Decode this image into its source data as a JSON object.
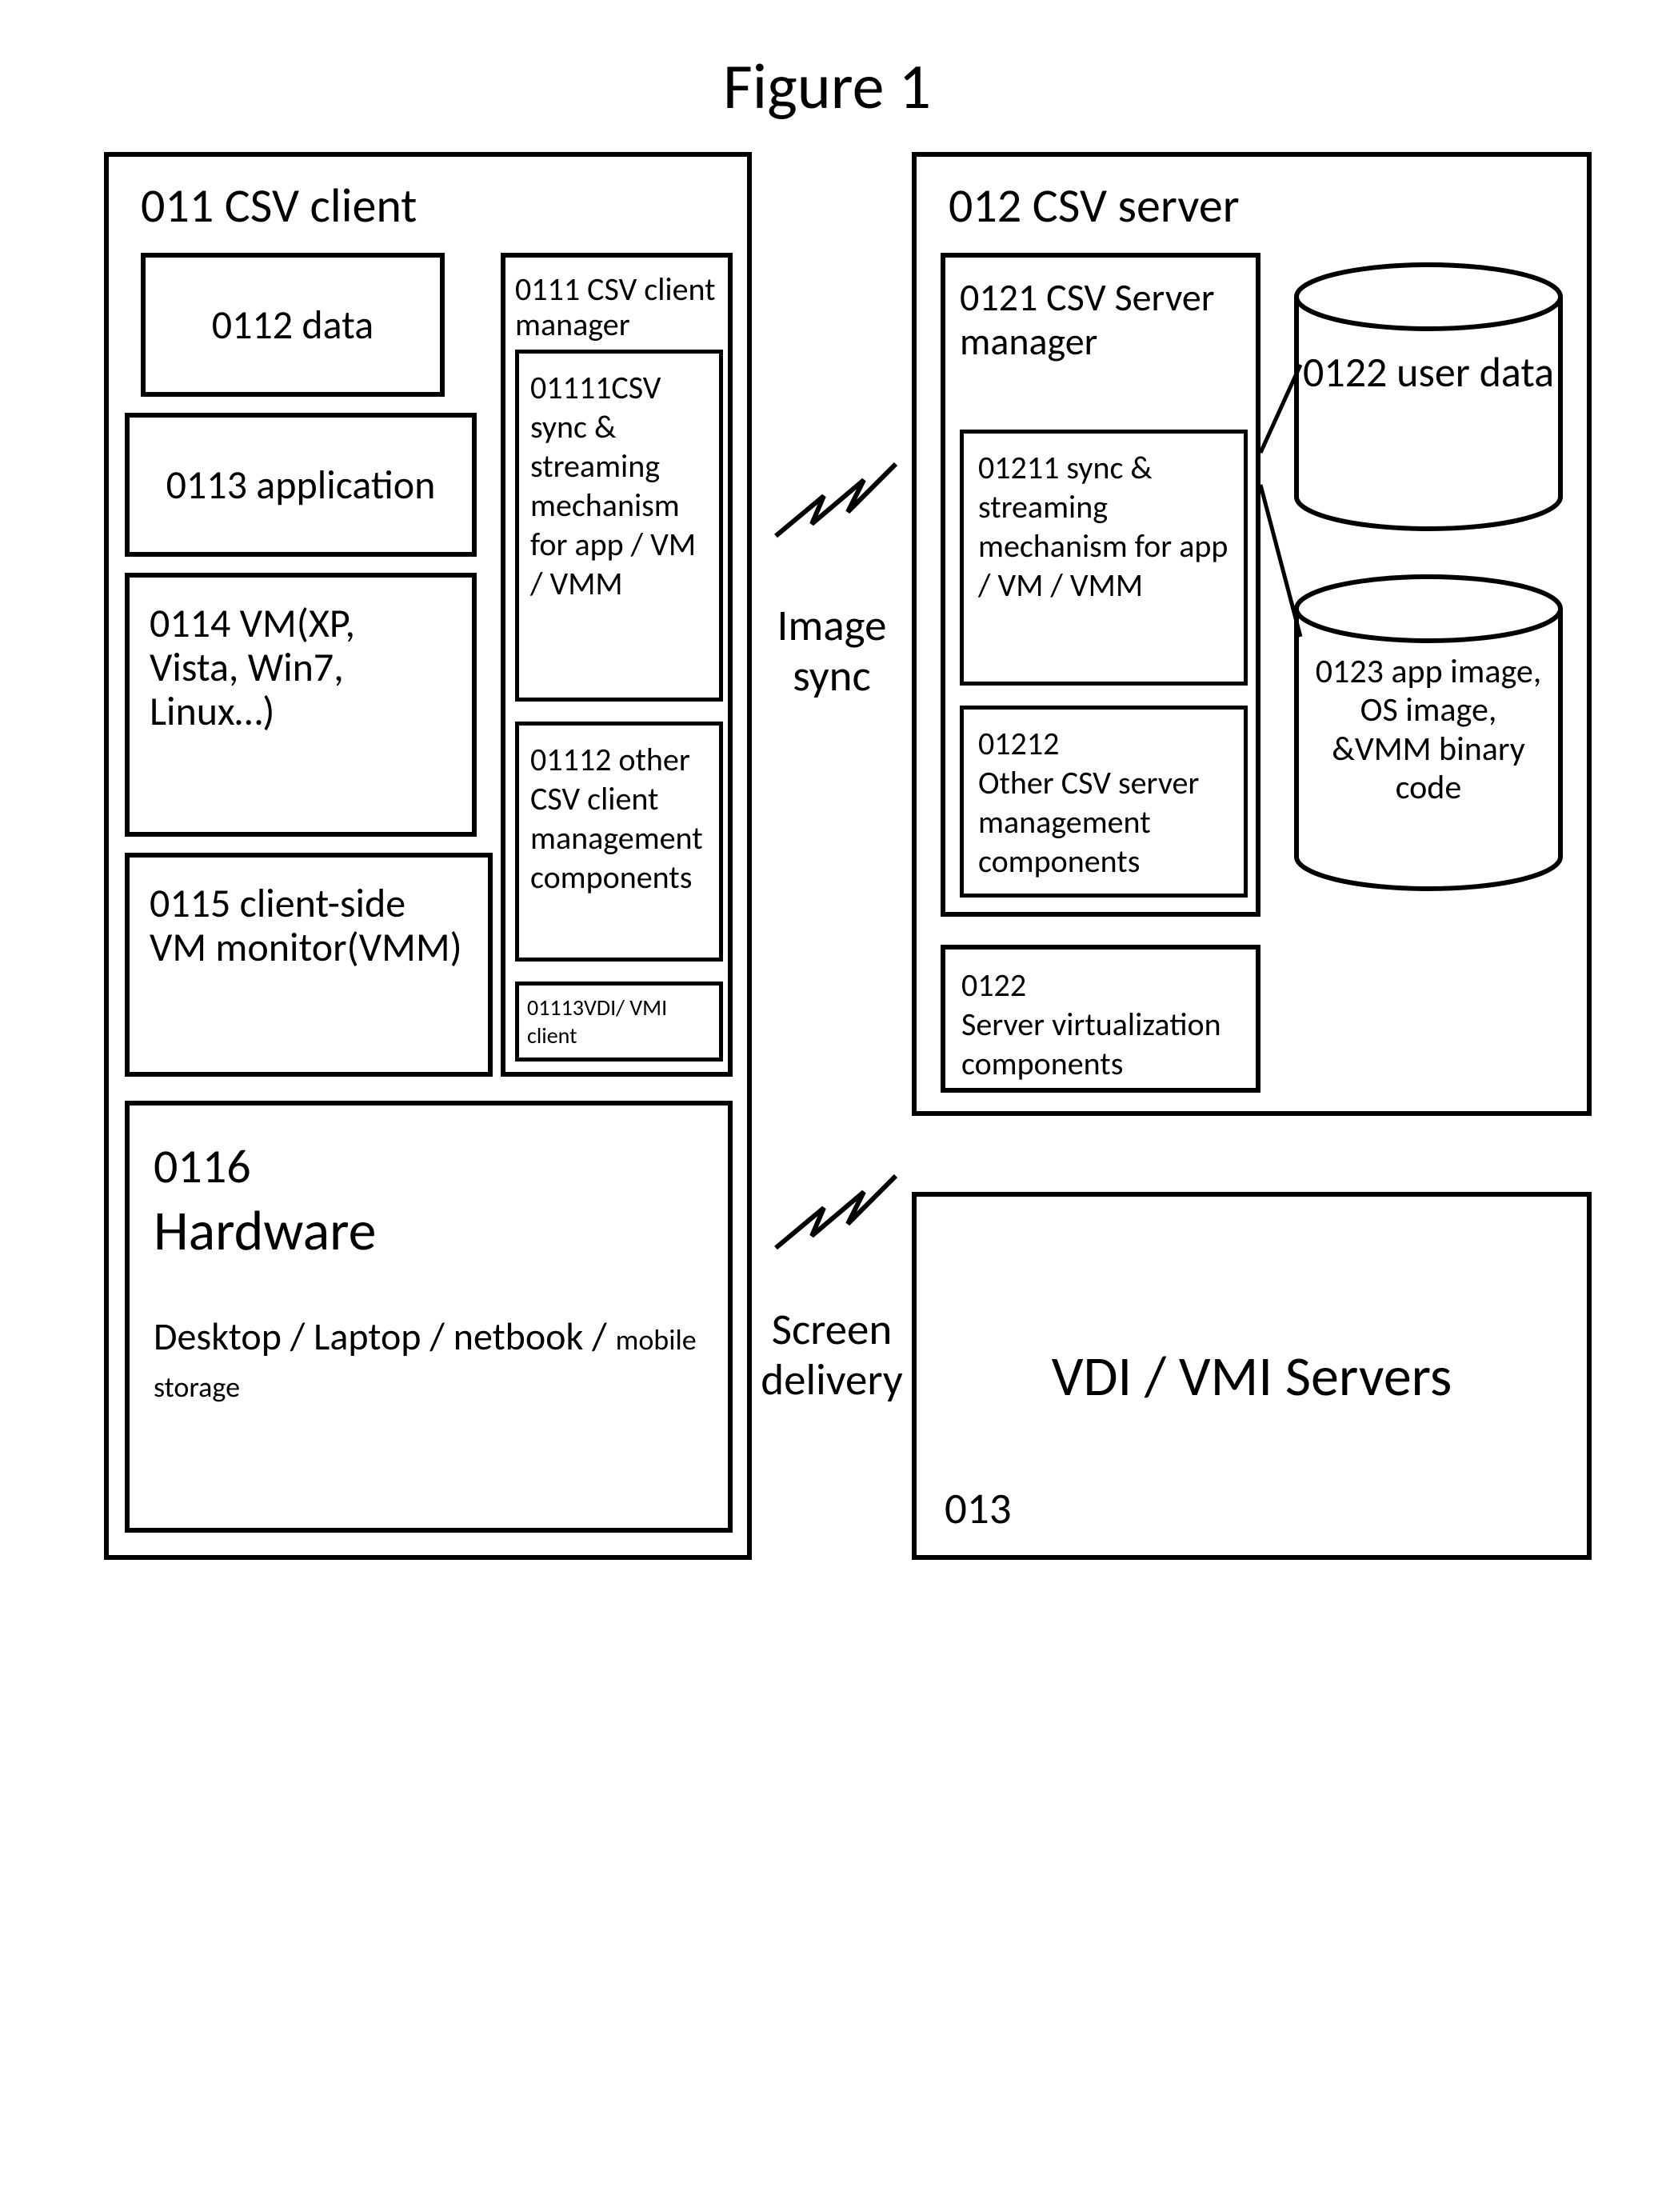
{
  "figure_title": "Figure 1",
  "client": {
    "title": "011    CSV  client",
    "data": "0112 data",
    "app": "0113 application",
    "vm": "0114 VM(XP, Vista, Win7, Linux…)",
    "vmm": "0115 client-side VM monitor(VMM)",
    "mgr": {
      "title": "0111 CSV client manager",
      "sync": "01111CSV sync & streaming mechanism for  app / VM / VMM",
      "other": "01112 other CSV client management components",
      "vdi": "01113VDI/ VMI client"
    },
    "hw": {
      "id": "0116",
      "name": "Hardware",
      "sub": "Desktop / Laptop / netbook /",
      "sub2": "mobile storage"
    }
  },
  "mid": {
    "sync": "Image sync",
    "screen": "Screen delivery"
  },
  "server": {
    "title": "012   CSV server",
    "mgr": {
      "title": "0121 CSV Server manager",
      "sync": "01211 sync & streaming mechanism for app / VM / VMM",
      "other": "01212\nOther CSV server management components"
    },
    "virt": "0122\nServer virtualization components",
    "cyl_user": "0122 user data",
    "cyl_app": "0123 app image, OS image, &VMM binary code"
  },
  "vdi": {
    "id": "013",
    "label": "VDI / VMI Servers"
  }
}
